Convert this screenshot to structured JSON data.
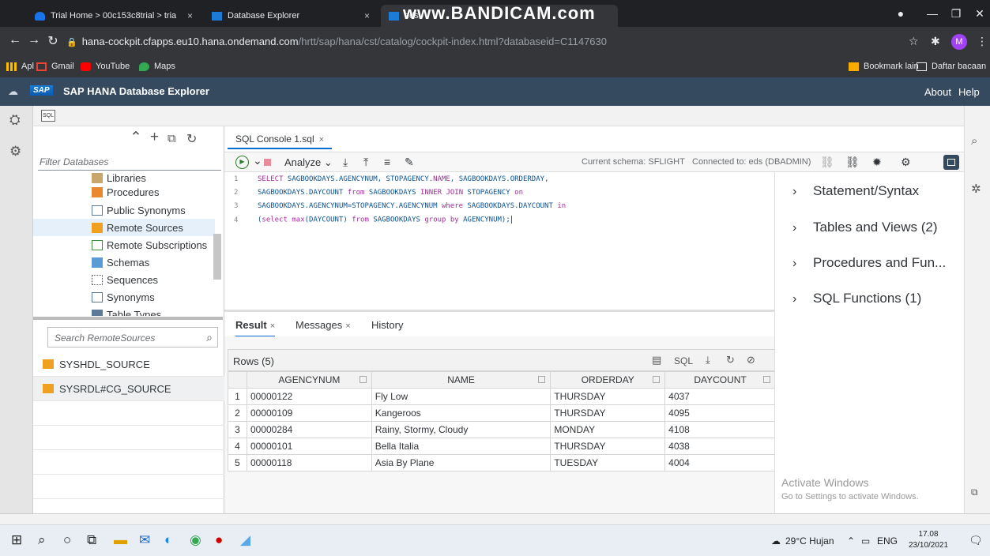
{
  "browser": {
    "tabs": [
      {
        "label": "Trial Home > 00c153c8trial > tria",
        "close": "×"
      },
      {
        "label": "Database Explorer",
        "close": "×"
      },
      {
        "label": "eds - ",
        "close": ""
      }
    ],
    "watermark": "www.BANDICAM.com",
    "url_host": "hana-cockpit.cfapps.eu10.hana.ondemand.com",
    "url_path": "/hrtt/sap/hana/cst/catalog/cockpit-index.html?databaseid=C1147630",
    "avatar_letter": "M",
    "bookmarks": [
      "Apl",
      "Gmail",
      "YouTube",
      "Maps"
    ],
    "bookmarks_right": [
      "Bookmark lain",
      "Daftar bacaan"
    ]
  },
  "shell": {
    "brand": "SAP",
    "title": "SAP HANA Database Explorer",
    "about": "About",
    "help": "Help"
  },
  "toolbar_chip": "SQL",
  "catalog": {
    "filter_placeholder": "Filter Databases",
    "tree": [
      {
        "label": "Libraries"
      },
      {
        "label": "Procedures"
      },
      {
        "label": "Public Synonyms"
      },
      {
        "label": "Remote Sources"
      },
      {
        "label": "Remote Subscriptions"
      },
      {
        "label": "Schemas"
      },
      {
        "label": "Sequences"
      },
      {
        "label": "Synonyms"
      },
      {
        "label": "Table Types"
      }
    ],
    "search_placeholder": "Search RemoteSources",
    "remote_sources": [
      "SYSHDL_SOURCE",
      "SYSRDL#CG_SOURCE"
    ]
  },
  "editor": {
    "tab_label": "SQL Console 1.sql",
    "analyze": "Analyze",
    "current_schema": "Current schema: SFLIGHT",
    "connected_to": "Connected to: eds (DBADMIN)",
    "lines": [
      {
        "n": "1",
        "a": "SELECT",
        "b": " SAGBOOKDAYS.AGENCYNUM, STOPAGENCY.",
        "c": "NAME",
        "d": ", SAGBOOKDAYS.ORDERDAY,"
      },
      {
        "n": "2",
        "a": "SAGBOOKDAYS.DAYCOUNT ",
        "b": "from",
        "c": " SAGBOOKDAYS ",
        "d": "INNER JOIN",
        "e": " STOPAGENCY ",
        "f": "on"
      },
      {
        "n": "3",
        "a": "SAGBOOKDAYS.AGENCYNUM=STOPAGENCY.AGENCYNUM ",
        "b": "where",
        "c": " SAGBOOKDAYS.DAYCOUNT ",
        "d": "in"
      },
      {
        "n": "4",
        "a": "(",
        "b": "select max",
        "c": "(DAYCOUNT) ",
        "d": "from",
        "e": " SAGBOOKDAYS ",
        "f": "group by",
        "g": " AGENCYNUM);"
      }
    ]
  },
  "results": {
    "tabs": [
      "Result",
      "Messages",
      "History"
    ],
    "rows_label": "Rows (5)",
    "sql_label": "SQL",
    "columns": [
      "AGENCYNUM",
      "NAME",
      "ORDERDAY",
      "DAYCOUNT"
    ],
    "rows": [
      [
        "1",
        "00000122",
        "Fly Low",
        "THURSDAY",
        "4037"
      ],
      [
        "2",
        "00000109",
        "Kangeroos",
        "THURSDAY",
        "4095"
      ],
      [
        "3",
        "00000284",
        "Rainy, Stormy, Cloudy",
        "MONDAY",
        "4108"
      ],
      [
        "4",
        "00000101",
        "Bella Italia",
        "THURSDAY",
        "4038"
      ],
      [
        "5",
        "00000118",
        "Asia By Plane",
        "TUESDAY",
        "4004"
      ]
    ]
  },
  "side_panel": {
    "items": [
      "Statement/Syntax",
      "Tables and Views (2)",
      "Procedures and Fun...",
      "SQL Functions (1)"
    ],
    "activate_title": "Activate Windows",
    "activate_sub": "Go to Settings to activate Windows."
  },
  "taskbar": {
    "weather": "29°C Hujan",
    "lang": "ENG",
    "time": "17.08",
    "date": "23/10/2021"
  }
}
